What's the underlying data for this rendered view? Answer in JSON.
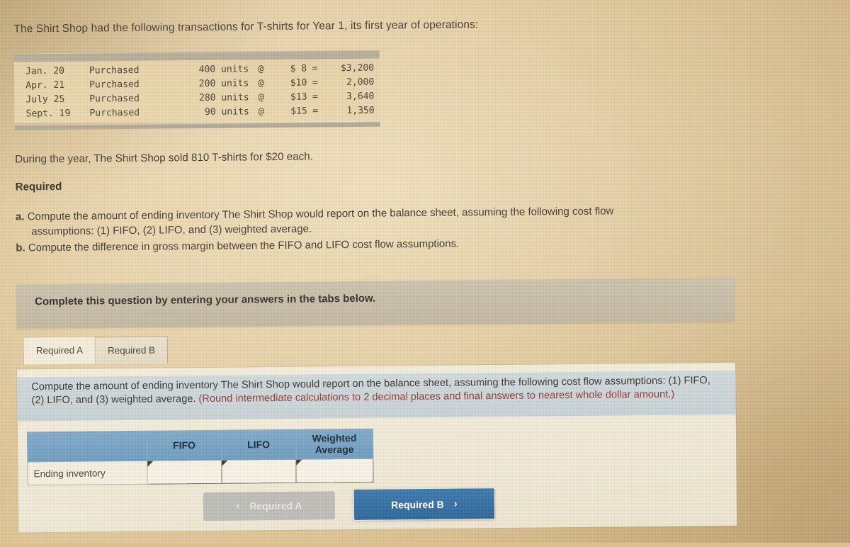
{
  "intro": "The Shirt Shop had the following transactions for T-shirts for Year 1, its first year of operations:",
  "transactions": {
    "rows": [
      {
        "date": "Jan. 20",
        "action": "Purchased",
        "units": "400 units",
        "at": "@",
        "price": "$ 8",
        "eq": "=",
        "total": "$3,200"
      },
      {
        "date": "Apr. 21",
        "action": "Purchased",
        "units": "200 units",
        "at": "@",
        "price": "$10",
        "eq": "=",
        "total": "2,000"
      },
      {
        "date": "July 25",
        "action": "Purchased",
        "units": "280 units",
        "at": "@",
        "price": "$13",
        "eq": "=",
        "total": "3,640"
      },
      {
        "date": "Sept. 19",
        "action": "Purchased",
        "units": "90 units",
        "at": "@",
        "price": "$15",
        "eq": "=",
        "total": "1,350"
      }
    ]
  },
  "sold_line": "During the year, The Shirt Shop sold 810 T-shirts for $20 each.",
  "required_heading": "Required",
  "requirements": {
    "a_label": "a.",
    "a_line1": "Compute the amount of ending inventory The Shirt Shop would report on the balance sheet, assuming the following cost flow",
    "a_line2": "assumptions: (1) FIFO, (2) LIFO, and (3) weighted average.",
    "b_label": "b.",
    "b_text": "Compute the difference in gross margin between the FIFO and LIFO cost flow assumptions."
  },
  "banner": {
    "text": "Complete this question by entering your answers in the tabs below."
  },
  "tabs": [
    {
      "label": "Required A",
      "active": true
    },
    {
      "label": "Required B",
      "active": false
    }
  ],
  "question": {
    "black_part": "Compute the amount of ending inventory The Shirt Shop would report on the balance sheet, assuming the following cost flow assumptions: (1) FIFO, (2) LIFO, and (3) weighted average. ",
    "red_part": "(Round intermediate calculations to 2 decimal places and final answers to nearest whole dollar amount.)"
  },
  "answer_table": {
    "headers": [
      "",
      "FIFO",
      "LIFO",
      "Weighted Average"
    ],
    "row_label": "Ending inventory",
    "values": [
      "",
      "",
      ""
    ]
  },
  "nav": {
    "prev_label": "Required A",
    "prev_chevron": "‹",
    "next_label": "Required B",
    "next_chevron": "›"
  },
  "colors": {
    "page_bg": "#dcc08f",
    "banner_bg": "#c5bba6",
    "panel_bg": "#f1ead8",
    "question_band": "#cbd5d8",
    "table_header_blue": "#6f9cbd",
    "next_button_blue": "#2e6699",
    "prev_button_gray": "#bdbcb7",
    "red_text": "#8f3b34"
  }
}
